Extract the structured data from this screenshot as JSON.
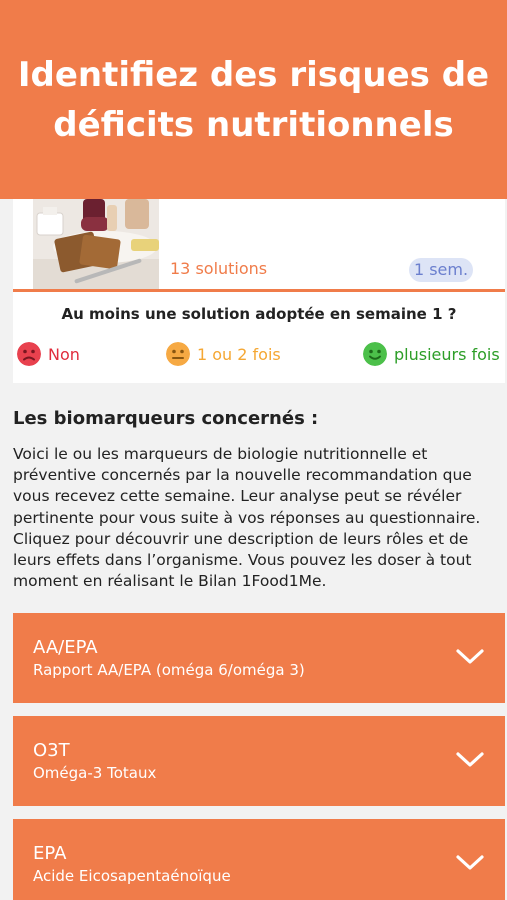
{
  "header": {
    "title": "Identifiez des risques de déficits nutritionnels"
  },
  "recommendation_card": {
    "image_icon": "breakfast-food-photo",
    "solutions_label": "13 solutions",
    "duration_badge": "1 sem.",
    "question": "Au moins une solution adoptée en semaine 1 ?",
    "options": [
      {
        "label": "Non",
        "icon": "sad-face-icon",
        "color": "#e02c3c"
      },
      {
        "label": "1 ou 2 fois",
        "icon": "neutral-face-icon",
        "color": "#f5a733"
      },
      {
        "label": "plusieurs fois",
        "icon": "happy-face-icon",
        "color": "#2d9e28"
      }
    ]
  },
  "biomarkers": {
    "title": "Les biomarqueurs concernés :",
    "description": "Voici le ou les marqueurs de biologie nutritionnelle et préventive concernés par la nouvelle recommandation que vous recevez cette semaine. Leur analyse peut se révéler pertinente pour vous suite à vos réponses au questionnaire. Cliquez pour découvrir une description de leurs rôles et de leurs effets dans l’organisme. Vous pouvez les doser à tout moment en réalisant le Bilan 1Food1Me.",
    "items": [
      {
        "name": "AA/EPA",
        "subtitle": "Rapport AA/EPA (oméga 6/oméga 3)"
      },
      {
        "name": "O3T",
        "subtitle": "Oméga-3 Totaux"
      },
      {
        "name": "EPA",
        "subtitle": "Acide Eicosapentaénoïque"
      }
    ]
  },
  "colors": {
    "accent": "#f07c4a",
    "badge_bg": "#dde4f6",
    "badge_text": "#6b7fce"
  }
}
